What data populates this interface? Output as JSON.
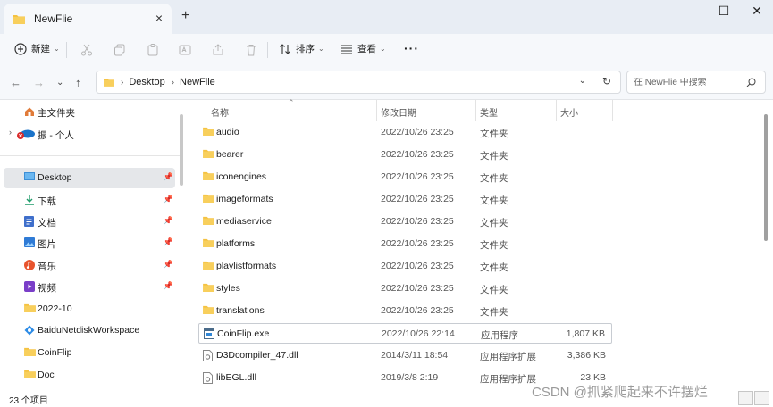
{
  "window": {
    "tab_title": "NewFlie",
    "tab_close": "×",
    "new_tab": "+",
    "minimize": "—",
    "maximize": "☐",
    "close": "✕"
  },
  "toolbar": {
    "new_label": "新建",
    "sort_label": "排序",
    "view_label": "查看",
    "more_label": "···"
  },
  "address": {
    "crumbs": [
      "Desktop",
      "NewFlie"
    ],
    "search_placeholder": "在 NewFlie 中搜索"
  },
  "sidebar": {
    "items": [
      {
        "label": "主文件夹",
        "icon": "home-icon",
        "pinned": false
      },
      {
        "label": "振 - 个人",
        "icon": "onedrive-icon",
        "pinned": false
      },
      {
        "label": "Desktop",
        "icon": "desktop-icon",
        "pinned": true,
        "selected": true
      },
      {
        "label": "下载",
        "icon": "download-icon",
        "pinned": true
      },
      {
        "label": "文档",
        "icon": "document-icon",
        "pinned": true
      },
      {
        "label": "图片",
        "icon": "image-icon",
        "pinned": true
      },
      {
        "label": "音乐",
        "icon": "music-icon",
        "pinned": true
      },
      {
        "label": "视频",
        "icon": "video-icon",
        "pinned": true
      },
      {
        "label": "2022-10",
        "icon": "folder-icon",
        "pinned": false
      },
      {
        "label": "BaiduNetdiskWorkspace",
        "icon": "baidu-icon",
        "pinned": false
      },
      {
        "label": "CoinFlip",
        "icon": "folder-icon",
        "pinned": false
      },
      {
        "label": "Doc",
        "icon": "folder-icon",
        "pinned": false
      }
    ],
    "pin_glyph": "📌"
  },
  "columns": {
    "name": "名称",
    "date": "修改日期",
    "type": "类型",
    "size": "大小"
  },
  "files": [
    {
      "name": "audio",
      "date": "2022/10/26 23:25",
      "type": "文件夹",
      "size": "",
      "icon": "folder-icon"
    },
    {
      "name": "bearer",
      "date": "2022/10/26 23:25",
      "type": "文件夹",
      "size": "",
      "icon": "folder-icon"
    },
    {
      "name": "iconengines",
      "date": "2022/10/26 23:25",
      "type": "文件夹",
      "size": "",
      "icon": "folder-icon"
    },
    {
      "name": "imageformats",
      "date": "2022/10/26 23:25",
      "type": "文件夹",
      "size": "",
      "icon": "folder-icon"
    },
    {
      "name": "mediaservice",
      "date": "2022/10/26 23:25",
      "type": "文件夹",
      "size": "",
      "icon": "folder-icon"
    },
    {
      "name": "platforms",
      "date": "2022/10/26 23:25",
      "type": "文件夹",
      "size": "",
      "icon": "folder-icon"
    },
    {
      "name": "playlistformats",
      "date": "2022/10/26 23:25",
      "type": "文件夹",
      "size": "",
      "icon": "folder-icon"
    },
    {
      "name": "styles",
      "date": "2022/10/26 23:25",
      "type": "文件夹",
      "size": "",
      "icon": "folder-icon"
    },
    {
      "name": "translations",
      "date": "2022/10/26 23:25",
      "type": "文件夹",
      "size": "",
      "icon": "folder-icon"
    },
    {
      "name": "CoinFlip.exe",
      "date": "2022/10/26 22:14",
      "type": "应用程序",
      "size": "1,807 KB",
      "icon": "exe-icon"
    },
    {
      "name": "D3Dcompiler_47.dll",
      "date": "2014/3/11 18:54",
      "type": "应用程序扩展",
      "size": "3,386 KB",
      "icon": "dll-icon"
    },
    {
      "name": "libEGL.dll",
      "date": "2019/3/8 2:19",
      "type": "应用程序扩展",
      "size": "23 KB",
      "icon": "dll-icon"
    }
  ],
  "status": {
    "count": "23 个项目"
  },
  "watermark": "CSDN @抓紧爬起来不许摆烂",
  "colors": {
    "folder": "#f5c242",
    "accent": "#0067c0",
    "selected_bg": "#e5e7ea"
  }
}
